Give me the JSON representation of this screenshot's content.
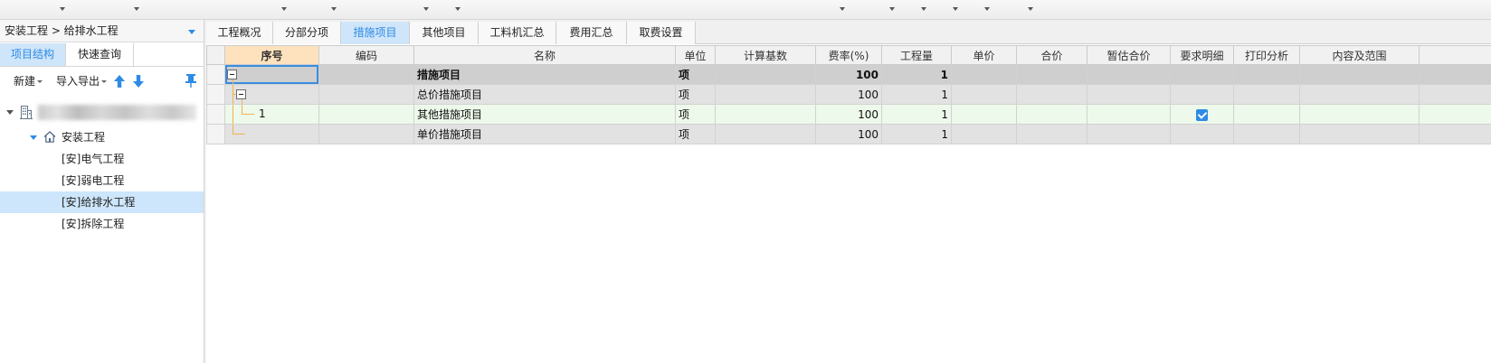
{
  "colors": {
    "accent": "#2d8be6",
    "active_tab_bg": "#cfe5f9",
    "selected_item_bg": "#cde6fb",
    "seq_header_bg": "#fde2bd",
    "root_row_bg": "#cfcfcf",
    "row_bg": "#e2e2e2",
    "highlight_row_bg": "#edf9ea",
    "tree_line": "#f2b24f",
    "focus_border": "#3b8de0"
  },
  "left_panel": {
    "breadcrumb": "安装工程 > 给排水工程",
    "tabs": [
      {
        "label": "项目结构"
      },
      {
        "label": "快速查询"
      }
    ],
    "active_tab": 0,
    "toolbar": {
      "new_label": "新建",
      "import_export_label": "导入导出"
    },
    "tree": {
      "group": {
        "label": "安装工程",
        "expanded": true
      },
      "items": [
        {
          "label": "[安]电气工程"
        },
        {
          "label": "[安]弱电工程"
        },
        {
          "label": "[安]给排水工程",
          "selected": true
        },
        {
          "label": "[安]拆除工程"
        }
      ]
    }
  },
  "main_tabs": {
    "items": [
      "工程概况",
      "分部分项",
      "措施项目",
      "其他项目",
      "工料机汇总",
      "费用汇总",
      "取费设置"
    ],
    "active": 2
  },
  "table": {
    "columns": [
      "序号",
      "编码",
      "名称",
      "单位",
      "计算基数",
      "费率(%)",
      "工程量",
      "单价",
      "合价",
      "暂估合价",
      "要求明细",
      "打印分析",
      "内容及范围"
    ],
    "rows": [
      {
        "level": 0,
        "expanded": true,
        "selected": true,
        "cells": [
          "",
          "",
          "措施项目",
          "项",
          "",
          "100",
          "1",
          "",
          "",
          "",
          "",
          "",
          ""
        ]
      },
      {
        "level": 1,
        "expanded": true,
        "cells": [
          "",
          "",
          "总价措施项目",
          "项",
          "",
          "100",
          "1",
          "",
          "",
          "",
          "",
          "",
          ""
        ]
      },
      {
        "level": 2,
        "highlighted": true,
        "require_detail_checked": true,
        "cells": [
          "1",
          "",
          "其他措施项目",
          "项",
          "",
          "100",
          "1",
          "",
          "",
          "",
          "",
          "",
          ""
        ]
      },
      {
        "level": 1,
        "cells": [
          "",
          "",
          "单价措施项目",
          "项",
          "",
          "100",
          "1",
          "",
          "",
          "",
          "",
          "",
          ""
        ]
      }
    ]
  }
}
